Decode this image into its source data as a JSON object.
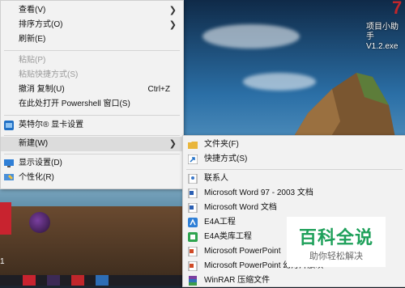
{
  "desktop": {
    "top_right_label": "项目小助手\nV1.2.exe",
    "bottom_left_text": "1"
  },
  "context_menu": {
    "items": [
      {
        "label": "查看(V)",
        "has_submenu": true
      },
      {
        "label": "排序方式(O)",
        "has_submenu": true
      },
      {
        "label": "刷新(E)"
      },
      {
        "label": "粘贴(P)",
        "disabled": true
      },
      {
        "label": "粘贴快捷方式(S)",
        "disabled": true
      },
      {
        "label": "撤消 复制(U)",
        "shortcut": "Ctrl+Z"
      },
      {
        "label": "在此处打开 Powershell 窗口(S)"
      },
      {
        "label": "英特尔® 显卡设置",
        "icon": "intel-graphics-icon"
      },
      {
        "label": "新建(W)",
        "has_submenu": true,
        "highlighted": true
      },
      {
        "label": "显示设置(D)",
        "icon": "display-settings-icon"
      },
      {
        "label": "个性化(R)",
        "icon": "personalize-icon"
      }
    ]
  },
  "new_submenu": {
    "items": [
      {
        "label": "文件夹(F)",
        "icon": "folder-icon"
      },
      {
        "label": "快捷方式(S)",
        "icon": "shortcut-icon"
      },
      {
        "label": "联系人",
        "icon": "contact-icon"
      },
      {
        "label": "Microsoft Word 97 - 2003 文档",
        "icon": "word-doc-icon"
      },
      {
        "label": "Microsoft Word 文档",
        "icon": "word-doc-icon"
      },
      {
        "label": "E4A工程",
        "icon": "e4a-project-icon"
      },
      {
        "label": "E4A类库工程",
        "icon": "e4a-library-icon"
      },
      {
        "label": "Microsoft PowerPoint",
        "icon": "powerpoint-icon"
      },
      {
        "label": "Microsoft PowerPoint 幻灯片放映",
        "icon": "powerpoint-show-icon"
      },
      {
        "label": "WinRAR 压缩文件",
        "icon": "winrar-icon"
      }
    ]
  },
  "watermark": {
    "title": "百科全说",
    "subtitle": "助你轻松解决"
  },
  "colors": {
    "menu_bg": "#f2f2f2",
    "highlight": "#dcdcdc",
    "watermark_green": "#1ea05a"
  }
}
